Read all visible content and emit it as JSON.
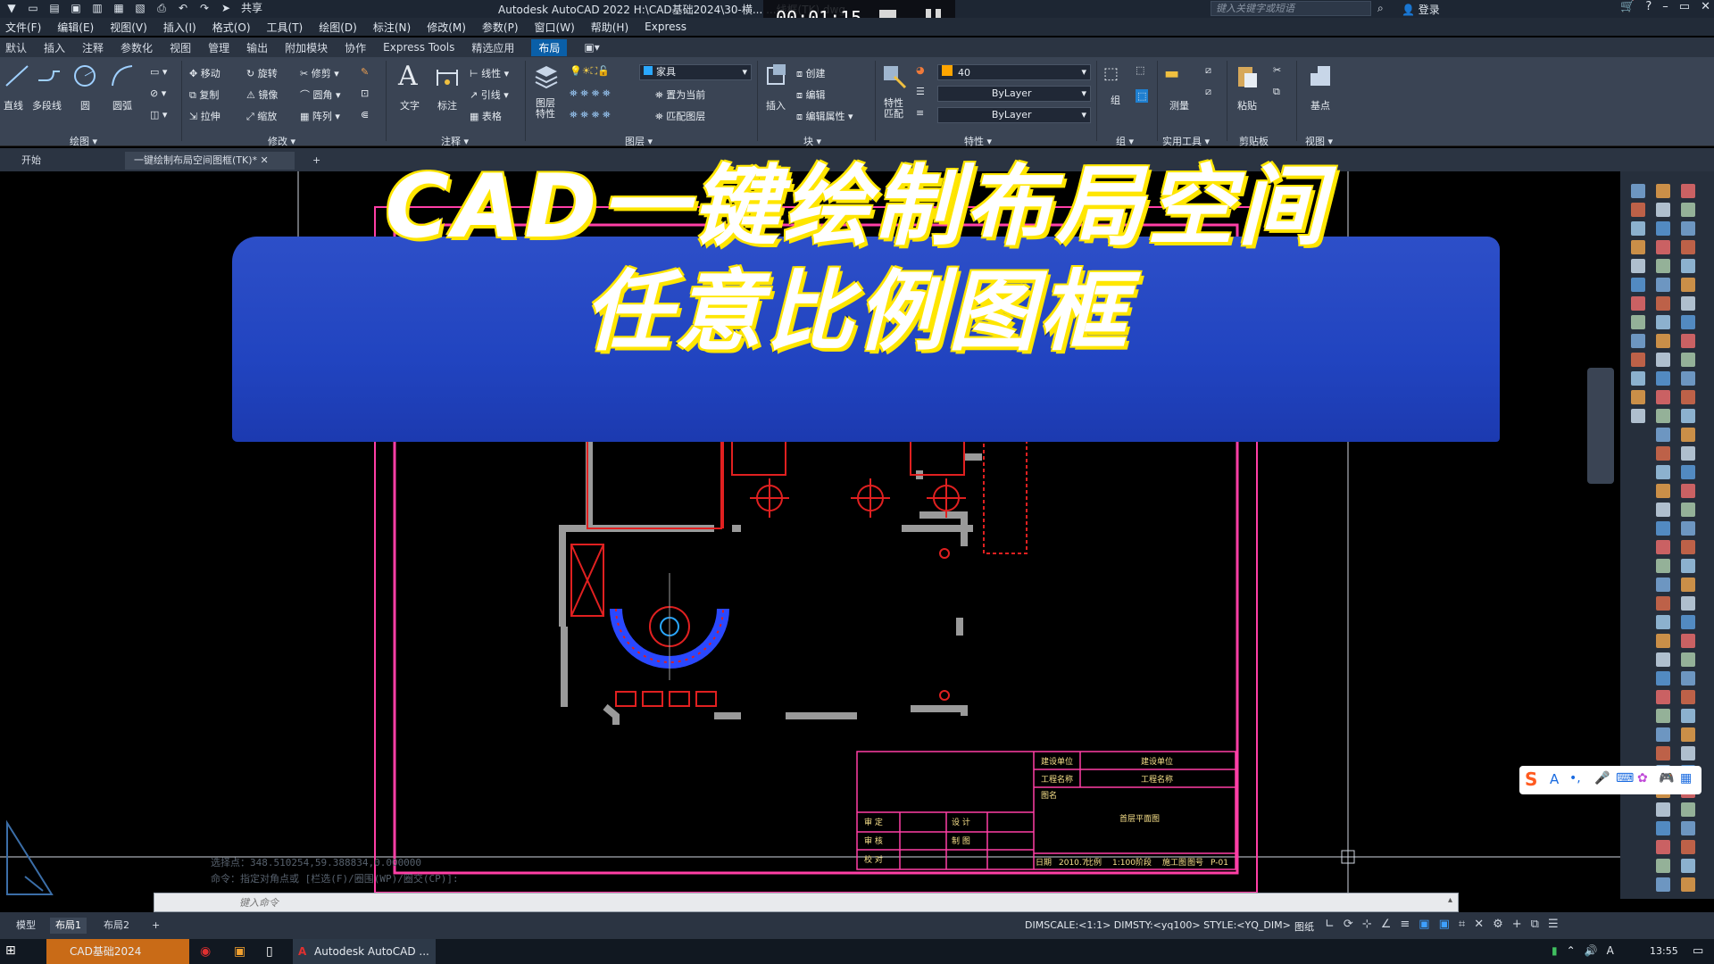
{
  "titlebar": {
    "share_label": "共享",
    "app_title": "Autodesk AutoCAD 2022    H:\\CAD基础2024\\30-横...       ...线框(TK).dwg",
    "search_placeholder": "键入关键字或短语",
    "login_label": "登录"
  },
  "recorder": {
    "timer": "00:01:15"
  },
  "menu": [
    "文件(F)",
    "编辑(E)",
    "视图(V)",
    "插入(I)",
    "格式(O)",
    "工具(T)",
    "绘图(D)",
    "标注(N)",
    "修改(M)",
    "参数(P)",
    "窗口(W)",
    "帮助(H)",
    "Express"
  ],
  "ribbon_tabs": [
    "默认",
    "插入",
    "注释",
    "参数化",
    "视图",
    "管理",
    "输出",
    "附加模块",
    "协作",
    "Express Tools",
    "精选应用",
    "布局"
  ],
  "ribbon": {
    "draw": {
      "line": "直线",
      "polyline": "多段线",
      "circle": "圆",
      "arc": "圆弧",
      "title": "绘图 ▾"
    },
    "modify": {
      "move": "移动",
      "rotate": "旋转",
      "trim": "修剪",
      "copy": "复制",
      "mirror": "镜像",
      "fillet": "圆角",
      "stretch": "拉伸",
      "scale": "缩放",
      "array": "阵列",
      "title": "修改 ▾"
    },
    "annotation": {
      "text": "文字",
      "dimension": "标注",
      "linear": "线性",
      "leader": "引线",
      "table": "表格",
      "title": "注释 ▾"
    },
    "layers": {
      "props": "图层\n特性",
      "current_layer": "家具",
      "set_current": "置为当前",
      "match_layer": "匹配图层",
      "title": "图层 ▾"
    },
    "block": {
      "insert": "插入",
      "create": "创建",
      "edit": "编辑",
      "edit_attr": "编辑属性",
      "title": "块 ▾"
    },
    "properties": {
      "match": "特性\n匹配",
      "color_value": "40",
      "linetype": "ByLayer",
      "lineweight": "ByLayer",
      "title": "特性 ▾"
    },
    "groups": {
      "group": "组",
      "title": "组 ▾"
    },
    "utilities": {
      "measure": "测量",
      "title": "实用工具 ▾"
    },
    "clipboard": {
      "paste": "粘贴",
      "title": "剪贴板"
    },
    "view": {
      "base": "基点",
      "title": "视图 ▾"
    }
  },
  "file_tabs": {
    "start": "开始",
    "drawing": "一键绘制布局空间图框(TK)*",
    "add": "+"
  },
  "banner": {
    "line1": "CAD一键绘制布局空间",
    "line2": "任意比例图框"
  },
  "title_block": {
    "construction_unit_label": "建设单位",
    "construction_unit_value": "建设单位",
    "project_label": "工程名称",
    "project_value": "工程名称",
    "drawing_name_label": "图名",
    "drawing_name_value": "首层平面图",
    "review": "审 定",
    "design": "设 计",
    "check": "审 核",
    "drafting": "制 图",
    "proofread": "校 对",
    "date_label": "日期",
    "date_value": "2010.7",
    "scale_label": "比例",
    "scale_value": "1:100",
    "stage_label": "阶段",
    "stage_value": "施工图",
    "sheet_label": "图号",
    "sheet_value": "P-01"
  },
  "command": {
    "history1": "选择点：348.510254,59.388834,0.000000",
    "history2": "命令：指定对角点或 [栏选(F)/圈围(WP)/圈交(CP)]:",
    "placeholder": "键入命令"
  },
  "layout_tabs": [
    "模型",
    "布局1",
    "布局2",
    "+"
  ],
  "status": {
    "dim_info": "DIMSCALE:<1:1> DIMSTY:<yq100> STYLE:<YQ_DIM>",
    "paper": "图纸"
  },
  "taskbar": {
    "folder_app": "CAD基础2024",
    "autocad_app": "Autodesk AutoCAD ...",
    "ime_letter": "A",
    "clock": "13:55"
  },
  "colors": {
    "frame_outer": "#ff3fa6",
    "frame_inner": "#ff3fa6",
    "walls": "#9a9a9a",
    "red_elements": "#e02020",
    "banner": "#2549c6",
    "banner_text_outline": "#ffe600",
    "active_tab": "#0a5fa8"
  }
}
